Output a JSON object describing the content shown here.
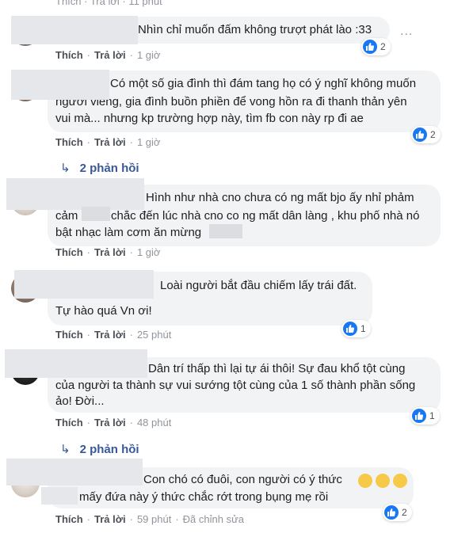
{
  "top_fragment": "Thích · Trả lời · 11 phút",
  "actions": {
    "like": "Thích",
    "reply": "Trả lời"
  },
  "comments": [
    {
      "lines": [
        "Nhìn chỉ muốn đấm không trượt phát lào :33"
      ],
      "time": "1 giờ",
      "reactions": "2",
      "more": "..."
    },
    {
      "lines": [
        "Có một số gia đình thì đám tang họ có ý nghĩ không muốn",
        "người viếng, gia đình buồn phiền để vong hồn ra đi thanh thản yên",
        "vui mà... nhưng kp trường hợp này, tìm fb con này rp đi ae"
      ],
      "time": "1 giờ",
      "reactions": "2",
      "replies": "2 phản hồi"
    },
    {
      "lines": [
        "Hình như nhà cno chưa có ng mất bjo ấy nhỉ phảm",
        "cảm",
        "chắc đến lúc nhà cno co ng mất dân làng , khu phố nhà nó",
        "bật nhạc làm cơm ăn mừng"
      ],
      "time": "1 giờ"
    },
    {
      "lines": [
        "Loài người bắt đầu chiếm lấy trái đất.",
        "Tự hào quá Vn ơi!"
      ],
      "time": "25 phút",
      "reactions": "1"
    },
    {
      "lines": [
        "Dân trí thấp thì lại tự ái thôi! Sự đau khổ tột cùng",
        "của người ta thành sự vui sướng tột cùng của 1 số thành phần sống",
        "ảo! Đời..."
      ],
      "time": "48 phút",
      "reactions": "1",
      "replies": "2 phản hồi"
    },
    {
      "lines": [
        "Con chó có đuôi, con người có ý thức",
        "mấy đứa này ý thức chắc rớt trong bụng mẹ rồi"
      ],
      "time": "59 phút",
      "edited": "Đã chỉnh sửa",
      "reactions": "2"
    }
  ],
  "colors": {
    "like": "#1877f2",
    "link": "#385898",
    "bubble": "#f2f3f5",
    "meta": "#90949c"
  }
}
